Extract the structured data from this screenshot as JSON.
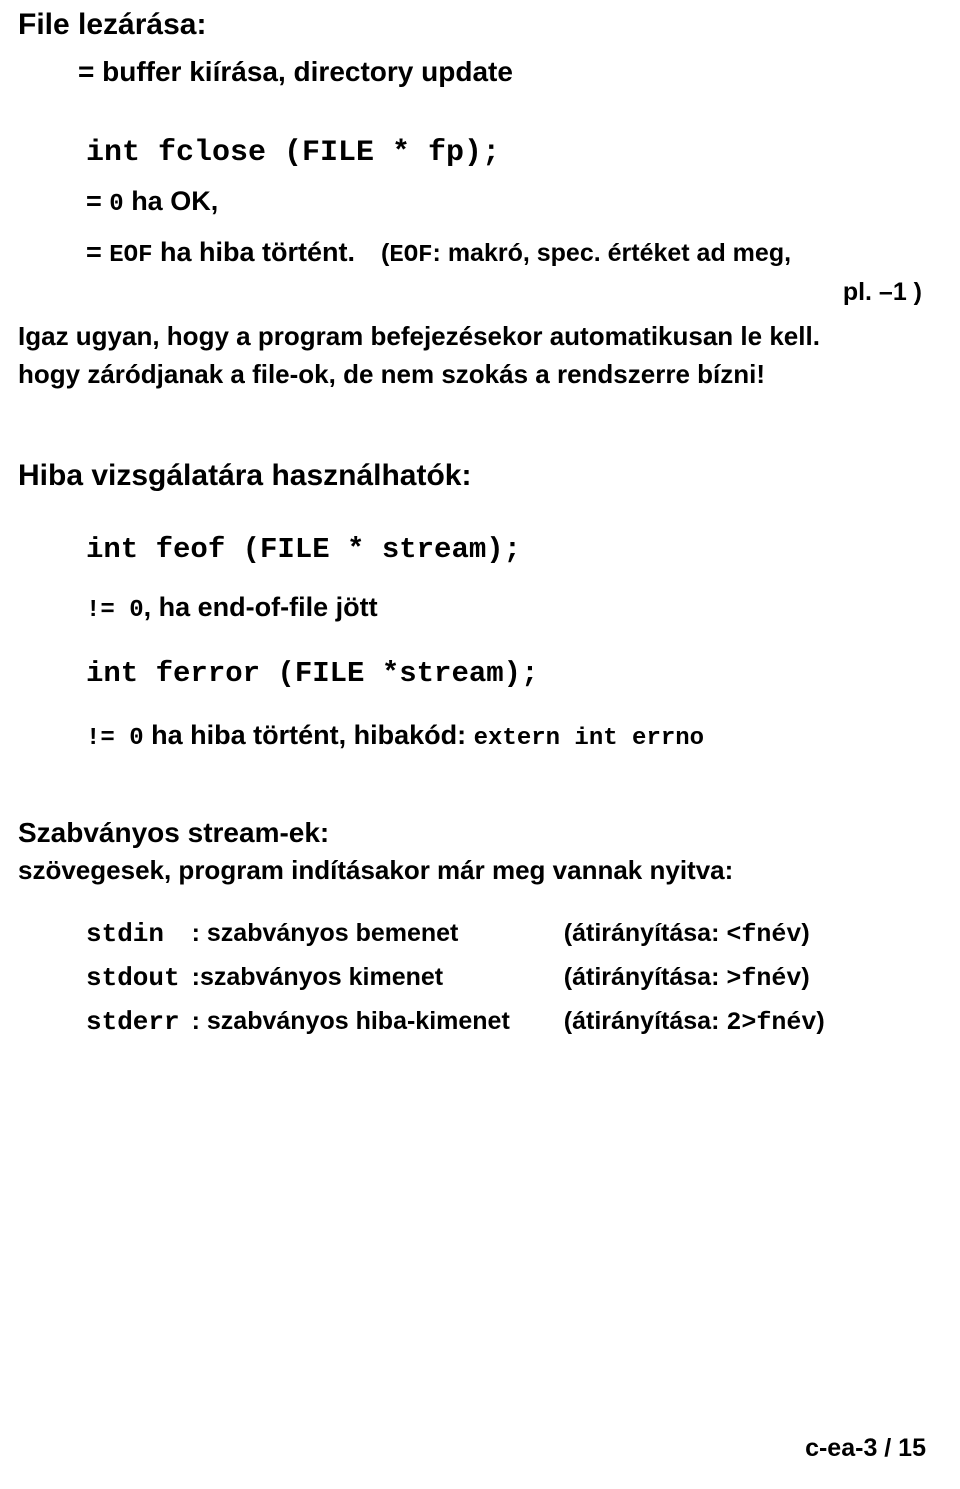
{
  "document": {
    "heading": {
      "title": "File lezárása:",
      "subtitle": "= buffer kiírása, directory update"
    },
    "fclose_block": {
      "signature": "int fclose (FILE * fp);",
      "ok_line": "= 0 ha OK,",
      "ok_code": "0",
      "ok_prefix": "= ",
      "ok_suffix": " ha OK,",
      "eof_prefix": "= ",
      "eof_code": "EOF",
      "eof_text": " ha hiba történt.",
      "eof_note_open": "(",
      "eof_note_code": "EOF",
      "eof_note_text": ": makró, spec. értéket ad meg,",
      "eof_note_end": "pl. –1 )"
    },
    "paragraphs": {
      "igaz": "Igaz ugyan, hogy a program befejezésekor automatikusan le kell.",
      "hogy": "hogy záródjanak a file-ok, de nem szokás a rendszerre bízni!"
    },
    "error_section": {
      "heading": "Hiba vizsgálatára használhatók:",
      "feof_signature": "int feof (FILE * stream);",
      "feof_result_code": "!= 0",
      "feof_result_text": ", ha end-of-file jött",
      "ferror_signature": "int ferror (FILE *stream);",
      "ferror_result_code": "!= 0",
      "ferror_result_text": " ha hiba történt, hibakód: ",
      "ferror_errno": "extern int errno"
    },
    "streams_section": {
      "heading": "Szabványos stream-ek:",
      "subheading": "szövegesek, program indításakor már meg vannak nyitva:",
      "rows": [
        {
          "name": "stdin",
          "desc": ": szabványos bemenet",
          "redirect_label": "(átirányítása: ",
          "redirect_code": "<fnév",
          "redirect_close": ")"
        },
        {
          "name": "stdout",
          "desc": ":szabványos kimenet",
          "redirect_label": "(átirányítása: ",
          "redirect_code": ">fnév",
          "redirect_close": ")"
        },
        {
          "name": "stderr",
          "desc": ": szabványos hiba-kimenet",
          "redirect_label": "(átirányítása: ",
          "redirect_code": "2>fnév",
          "redirect_close": ")"
        }
      ]
    },
    "footer": "c-ea-3 / 15"
  }
}
